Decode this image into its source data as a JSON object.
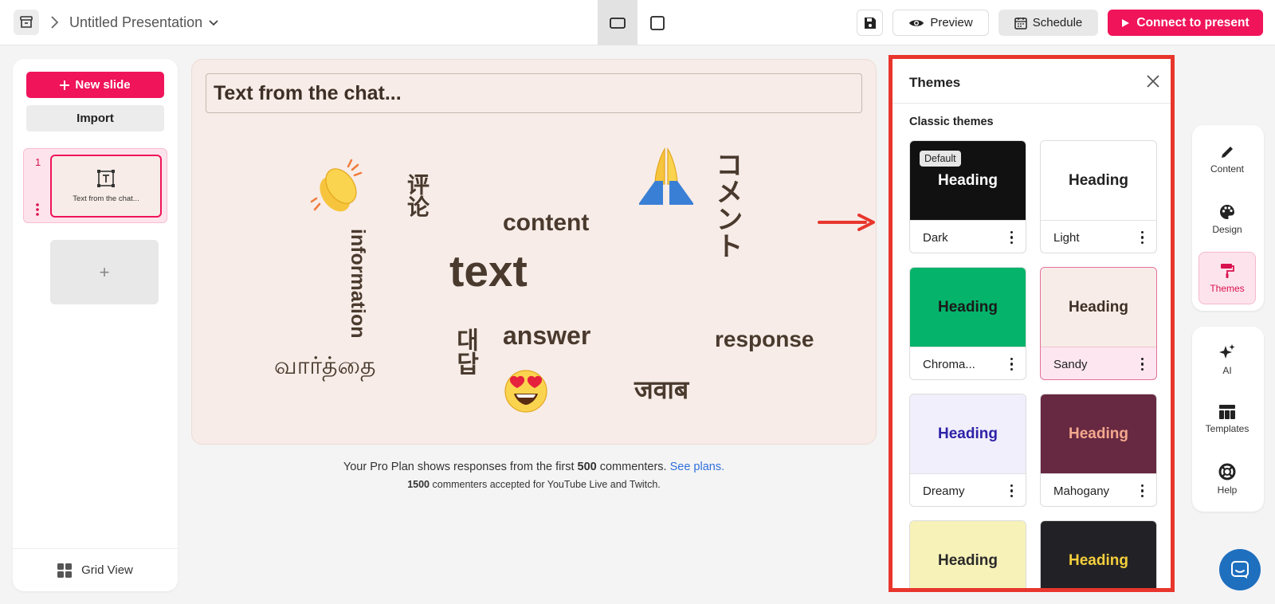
{
  "header": {
    "title": "Untitled Presentation",
    "preview_label": "Preview",
    "schedule_label": "Schedule",
    "connect_label": "Connect to present"
  },
  "sidebar": {
    "new_slide_label": "New slide",
    "import_label": "Import",
    "slides": [
      {
        "number": "1",
        "thumb_text": "Text from the chat..."
      }
    ],
    "add_slide_symbol": "+",
    "grid_view_label": "Grid View"
  },
  "canvas": {
    "title": "Text from the chat...",
    "words": {
      "content": "content",
      "text": "text",
      "answer": "answer",
      "response": "response",
      "tamil": "வார்த்தை",
      "javab": "जवाब",
      "information": "information",
      "pinglun": "评论",
      "daedap": "대답",
      "komento": "コメント"
    },
    "emojis": {
      "clap": "👏",
      "pray": "🙏",
      "heart_eyes": "😍"
    }
  },
  "plan_notice": {
    "prefix": "Your Pro Plan shows responses from the first ",
    "count": "500",
    "suffix": " commenters. ",
    "link": "See plans.",
    "line2_count": "1500",
    "line2_text": " commenters accepted for YouTube Live and Twitch."
  },
  "themes_panel": {
    "title": "Themes",
    "section_label": "Classic themes",
    "default_badge": "Default",
    "themes": [
      {
        "name": "Dark",
        "heading": "Heading",
        "bg": "#111111",
        "fg": "#ffffff"
      },
      {
        "name": "Light",
        "heading": "Heading",
        "bg": "#ffffff",
        "fg": "#222222"
      },
      {
        "name": "Chroma...",
        "heading": "Heading",
        "bg": "#05b36b",
        "fg": "#1a1a1a"
      },
      {
        "name": "Sandy",
        "heading": "Heading",
        "bg": "#f7ece7",
        "fg": "#3d2f26"
      },
      {
        "name": "Dreamy",
        "heading": "Heading",
        "bg": "#f1effb",
        "fg": "#2e22a8"
      },
      {
        "name": "Mahogany",
        "heading": "Heading",
        "bg": "#672841",
        "fg": "#f4a98d"
      },
      {
        "name": "",
        "heading": "Heading",
        "bg": "#f7f2b8",
        "fg": "#2a2a2a"
      },
      {
        "name": "",
        "heading": "Heading",
        "bg": "#222226",
        "fg": "#f4cf3c"
      }
    ]
  },
  "right_rail": {
    "content_label": "Content",
    "design_label": "Design",
    "themes_label": "Themes",
    "ai_label": "AI",
    "templates_label": "Templates",
    "help_label": "Help"
  },
  "colors": {
    "brand": "#f0145a",
    "highlight_border": "#e8362d",
    "link": "#2f6fdb"
  }
}
